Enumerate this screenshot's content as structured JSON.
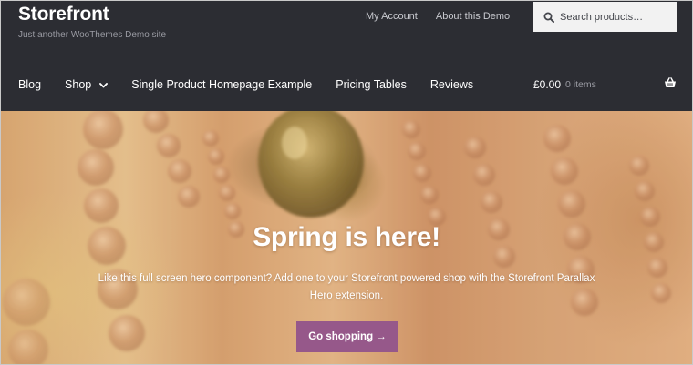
{
  "header": {
    "site_title": "Storefront",
    "tagline": "Just another WooThemes Demo site",
    "secondary_nav": [
      "My Account",
      "About this Demo"
    ],
    "search": {
      "placeholder": "Search products…",
      "icon": "search-icon"
    }
  },
  "primary_nav": {
    "items": [
      {
        "label": "Blog"
      },
      {
        "label": "Shop",
        "has_dropdown": true
      },
      {
        "label": "Single Product Homepage Example"
      },
      {
        "label": "Pricing Tables"
      },
      {
        "label": "Reviews"
      }
    ]
  },
  "cart": {
    "amount": "£0.00",
    "count": "0 items",
    "icon": "shopping-basket-icon"
  },
  "hero": {
    "title": "Spring is here!",
    "text": "Like this full screen hero component? Add one to your Storefront powered shop with the Storefront Parallax Hero extension.",
    "button_label": "Go shopping →"
  },
  "colors": {
    "header_bg": "#2c2d33",
    "accent": "#96588a",
    "search_bg": "#f2f2f2",
    "muted_text": "#9a9ba3"
  }
}
